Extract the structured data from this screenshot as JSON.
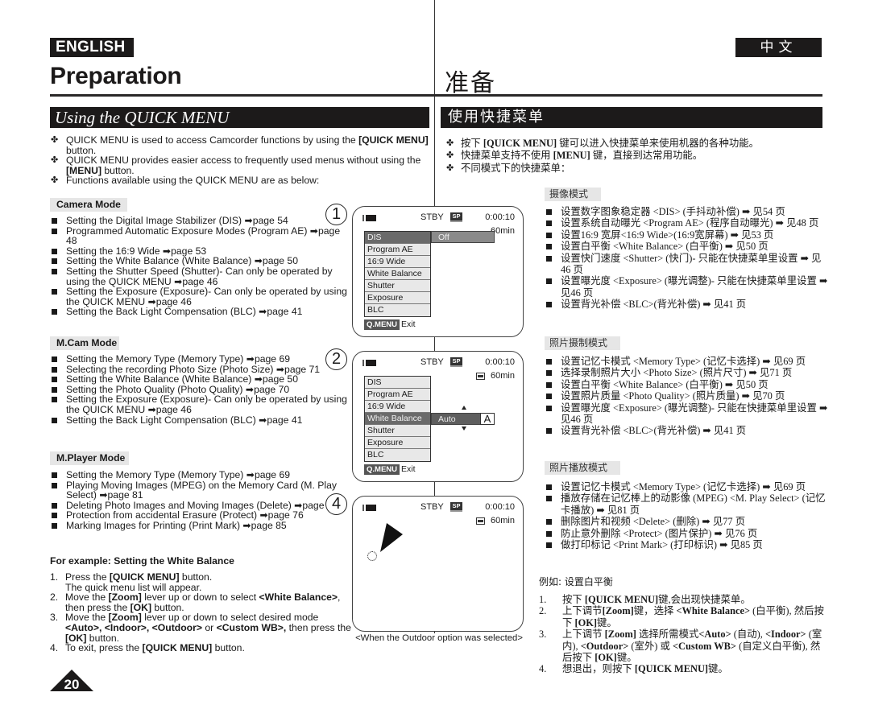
{
  "header": {
    "lang_en": "ENGLISH",
    "lang_zh": "中文",
    "title_en": "Preparation",
    "title_zh": "准备"
  },
  "section": {
    "title_en": "Using the QUICK MENU",
    "title_zh": "使用快捷菜单"
  },
  "intro_en": [
    {
      "pre": "QUICK MENU is used to access Camcorder functions by using the ",
      "bold": "[QUICK MENU]",
      "post": " button."
    },
    {
      "pre": "QUICK MENU provides easier access to frequently used menus without using the ",
      "bold": "[MENU]",
      "post": " button."
    },
    {
      "pre": "Functions available using the QUICK MENU are as below:",
      "bold": "",
      "post": ""
    }
  ],
  "intro_zh": [
    {
      "pre": "按下 ",
      "bold": "[QUICK MENU]",
      "post": " 键可以进入快捷菜单来使用机器的各种功能。"
    },
    {
      "pre": "快捷菜单支持不使用 ",
      "bold": "[MENU]",
      "post": " 键，直接到达常用功能。"
    },
    {
      "pre": "不同模式下的快捷菜单：",
      "bold": "",
      "post": ""
    }
  ],
  "modes_en": {
    "camera": {
      "label": "Camera Mode",
      "items": [
        "Setting the Digital Image Stabilizer (DIS) ➡page 54",
        "Programmed Automatic Exposure Modes (Program AE) ➡page 48",
        "Setting the 16:9 Wide ➡page 53",
        "Setting the White Balance (White Balance) ➡page 50",
        "Setting the Shutter Speed (Shutter)- Can only be operated by using the QUICK MENU ➡page 46",
        "Setting the Exposure (Exposure)- Can only be operated by using the QUICK MENU ➡page 46",
        "Setting the Back Light Compensation (BLC) ➡page 41"
      ]
    },
    "mcam": {
      "label": "M.Cam Mode",
      "items": [
        "Setting the Memory Type (Memory Type) ➡page 69",
        "Selecting the recording Photo Size (Photo Size) ➡page 71",
        "Setting the White Balance (White Balance) ➡page 50",
        "Setting the Photo Quality (Photo Quality) ➡page 70",
        "Setting the Exposure (Exposure)- Can only be operated by using the QUICK MENU ➡page 46",
        "Setting the Back Light Compensation (BLC) ➡page 41"
      ]
    },
    "mplayer": {
      "label": "M.Player Mode",
      "items": [
        "Setting the Memory Type (Memory Type) ➡page 69",
        "Playing Moving Images (MPEG) on the Memory Card (M. Play Select) ➡page 81",
        "Deleting Photo Images and Moving Images (Delete) ➡page 77",
        "Protection from accidental Erasure (Protect) ➡page 76",
        "Marking Images for Printing (Print Mark) ➡page 85"
      ]
    }
  },
  "modes_zh": {
    "camera": {
      "label": "摄像模式",
      "items": [
        "设置数字图象稳定器 <DIS> (手抖动补偿) ➡ 见54 页",
        "设置系统自动曝光 <Program AE> (程序自动曝光) ➡ 见48 页",
        "设置16:9 宽屏<16:9 Wide>(16:9宽屏幕) ➡ 见53 页",
        "设置白平衡 <White Balance> (白平衡) ➡ 见50 页",
        "设置快门速度 <Shutter> (快门)- 只能在快捷菜单里设置 ➡ 见46 页",
        "设置曝光度 <Exposure> (曝光调整)- 只能在快捷菜单里设置 ➡ 见46 页",
        "设置背光补偿 <BLC>(背光补偿) ➡ 见41 页"
      ]
    },
    "mcam": {
      "label": "照片摄制模式",
      "items": [
        "设置记忆卡模式 <Memory Type> (记忆卡选择) ➡ 见69 页",
        "选择录制照片大小 <Photo Size> (照片尺寸) ➡ 见71 页",
        "设置白平衡 <White Balance> (白平衡) ➡ 见50 页",
        "设置照片质量 <Photo Quality> (照片质量) ➡ 见70 页",
        "设置曝光度 <Exposure> (曝光调整)- 只能在快捷菜单里设置 ➡ 见46 页",
        "设置背光补偿 <BLC>(背光补偿) ➡ 见41 页"
      ]
    },
    "mplayer": {
      "label": "照片播放模式",
      "items": [
        "设置记忆卡模式 <Memory Type> (记忆卡选择) ➡ 见69 页",
        "播放存储在记忆棒上的动影像 (MPEG) <M. Play Select> (记忆卡播放) ➡ 见81 页",
        "删除图片和视频 <Delete> (删除) ➡ 见77 页",
        "防止意外删除 <Protect> (图片保护) ➡ 见76 页",
        "做打印标记 <Print Mark> (打印标识) ➡ 见85 页"
      ]
    }
  },
  "example_en": {
    "title": "For example: Setting the White Balance",
    "steps": [
      {
        "num": "1.",
        "html": "Press the <b>[QUICK MENU]</b> button.<br>The quick menu list will appear."
      },
      {
        "num": "2.",
        "html": "Move the <b>[Zoom]</b> lever up or down to select <b>&lt;White Balance&gt;</b>, then press the <b>[OK]</b> button."
      },
      {
        "num": "3.",
        "html": "Move the <b>[Zoom]</b> lever up or down to select desired mode <b>&lt;Auto&gt;, &lt;Indoor&gt;, &lt;Outdoor&gt;</b> or <b>&lt;Custom WB&gt;,</b> then press the <b>[OK]</b> button."
      },
      {
        "num": "4.",
        "html": "To exit, press the <b>[QUICK MENU]</b> button."
      }
    ]
  },
  "example_zh": {
    "title": "例如: 设置白平衡",
    "steps": [
      {
        "num": "1.",
        "html": "按下 <b>[QUICK MENU]</b>键,会出现快捷菜单。"
      },
      {
        "num": "2.",
        "html": "上下调节<b>[Zoom]</b>键，选择 <b>&lt;White Balance&gt;</b> (白平衡), 然后按下 <b>[OK]</b>键。"
      },
      {
        "num": "3.",
        "html": "上下调节 <b>[Zoom]</b> 选择所需模式<b>&lt;Auto&gt;</b> (自动), <b>&lt;Indoor&gt;</b> (室内), <b>&lt;Outdoor&gt;</b> (室外) 或 <b>&lt;Custom WB&gt;</b> (自定义白平衡), 然后按下 <b>[OK]</b>键。"
      },
      {
        "num": "4.",
        "html": "想退出，则按下 <b>[QUICK MENU]</b>键。"
      }
    ]
  },
  "page_number": "20",
  "lcd_panels": {
    "step_numbers": [
      "1",
      "2",
      "4"
    ],
    "status": {
      "mode": "STBY",
      "speed": "SP",
      "time": "0:00:10",
      "remaining": "60min"
    },
    "menu_items": [
      "DIS",
      "Program AE",
      "16:9 Wide",
      "White Balance",
      "Shutter",
      "Exposure",
      "BLC"
    ],
    "panel1": {
      "selected": "DIS",
      "value": "Off"
    },
    "panel2": {
      "selected": "White Balance",
      "value": "Auto",
      "value_icon": "A"
    },
    "qmenu_tag": "Q.MENU",
    "qmenu_action": "Exit",
    "caption": "<When the Outdoor option was selected>"
  }
}
